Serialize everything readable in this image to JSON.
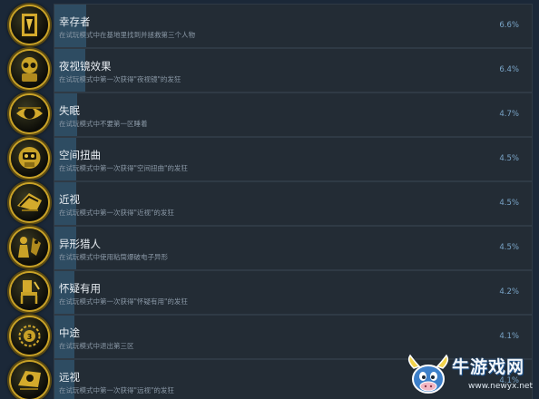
{
  "achievements": [
    {
      "title": "幸存者",
      "desc": "在试玩模式中在基地里找到并拯救第三个人物",
      "pct": "6.6%",
      "ratio": 0.066,
      "icon": "survivor-icon"
    },
    {
      "title": "夜视镜效果",
      "desc": "在试玩模式中第一次获得\"夜视镜\"的发狂",
      "pct": "6.4%",
      "ratio": 0.064,
      "icon": "night-vision-icon"
    },
    {
      "title": "失眠",
      "desc": "在试玩模式中不要第一区睡着",
      "pct": "4.7%",
      "ratio": 0.047,
      "icon": "eye-icon"
    },
    {
      "title": "空间扭曲",
      "desc": "在试玩模式中第一次获得\"空间扭曲\"的发狂",
      "pct": "4.5%",
      "ratio": 0.045,
      "icon": "space-warp-icon"
    },
    {
      "title": "近视",
      "desc": "在试玩模式中第一次获得\"近视\"的发狂",
      "pct": "4.5%",
      "ratio": 0.045,
      "icon": "myopia-icon"
    },
    {
      "title": "异形猎人",
      "desc": "在试玩模式中使用粘筒爆破电子异形",
      "pct": "4.5%",
      "ratio": 0.045,
      "icon": "alien-hunter-icon"
    },
    {
      "title": "怀疑有用",
      "desc": "在试玩模式中第一次获得\"怀疑有用\"的发狂",
      "pct": "4.2%",
      "ratio": 0.042,
      "icon": "chair-icon"
    },
    {
      "title": "中途",
      "desc": "在试玩模式中退出第三区",
      "pct": "4.1%",
      "ratio": 0.041,
      "icon": "midway-icon"
    },
    {
      "title": "远视",
      "desc": "在试玩模式中第一次获得\"远视\"的发狂",
      "pct": "4.1%",
      "ratio": 0.041,
      "icon": "hyperopia-icon"
    }
  ],
  "watermark": {
    "brand": "牛游戏网",
    "url": "www.newyx.net",
    "icon": "cow-mascot-icon"
  }
}
